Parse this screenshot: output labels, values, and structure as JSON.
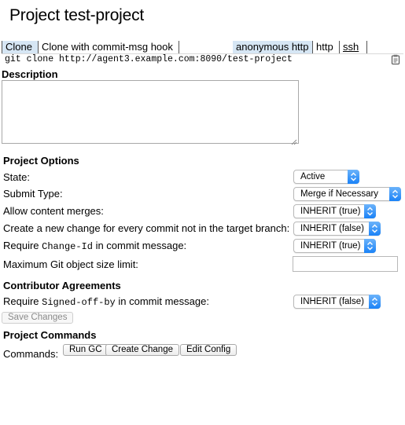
{
  "page": {
    "title": "Project test-project"
  },
  "clone": {
    "tabs": [
      {
        "label": "Clone",
        "selected": true
      },
      {
        "label": "Clone with commit-msg hook",
        "selected": false
      }
    ],
    "protocols": [
      {
        "label": "anonymous http",
        "selected": true
      },
      {
        "label": "http",
        "selected": false
      },
      {
        "label": "ssh",
        "selected": false
      }
    ],
    "command": "git clone http://agent3.example.com:8090/test-project",
    "copy_icon": "clipboard-icon"
  },
  "description": {
    "heading": "Description",
    "value": ""
  },
  "project_options": {
    "heading": "Project Options",
    "state": {
      "label": "State:",
      "value": "Active"
    },
    "submit_type": {
      "label": "Submit Type:",
      "value": "Merge if Necessary"
    },
    "allow_content_merges": {
      "label": "Allow content merges:",
      "value": "INHERIT (true)"
    },
    "new_change_per_commit": {
      "label": "Create a new change for every commit not in the target branch:",
      "value": "INHERIT (false)"
    },
    "require_change_id": {
      "label_prefix": "Require ",
      "label_code": "Change-Id",
      "label_suffix": " in commit message:",
      "value": "INHERIT (true)"
    },
    "max_object_size": {
      "label": "Maximum Git object size limit:",
      "value": ""
    }
  },
  "contributor_agreements": {
    "heading": "Contributor Agreements",
    "require_signed_off_by": {
      "label_prefix": "Require ",
      "label_code": "Signed-off-by",
      "label_suffix": " in commit message:",
      "value": "INHERIT (false)"
    }
  },
  "save_button": "Save Changes",
  "project_commands": {
    "heading": "Project Commands",
    "label": "Commands:",
    "buttons": [
      "Run GC",
      "Create Change",
      "Edit Config"
    ]
  },
  "colors": {
    "selected_tab": "#d6e6f4",
    "select_arrow": "#1a82f7"
  }
}
